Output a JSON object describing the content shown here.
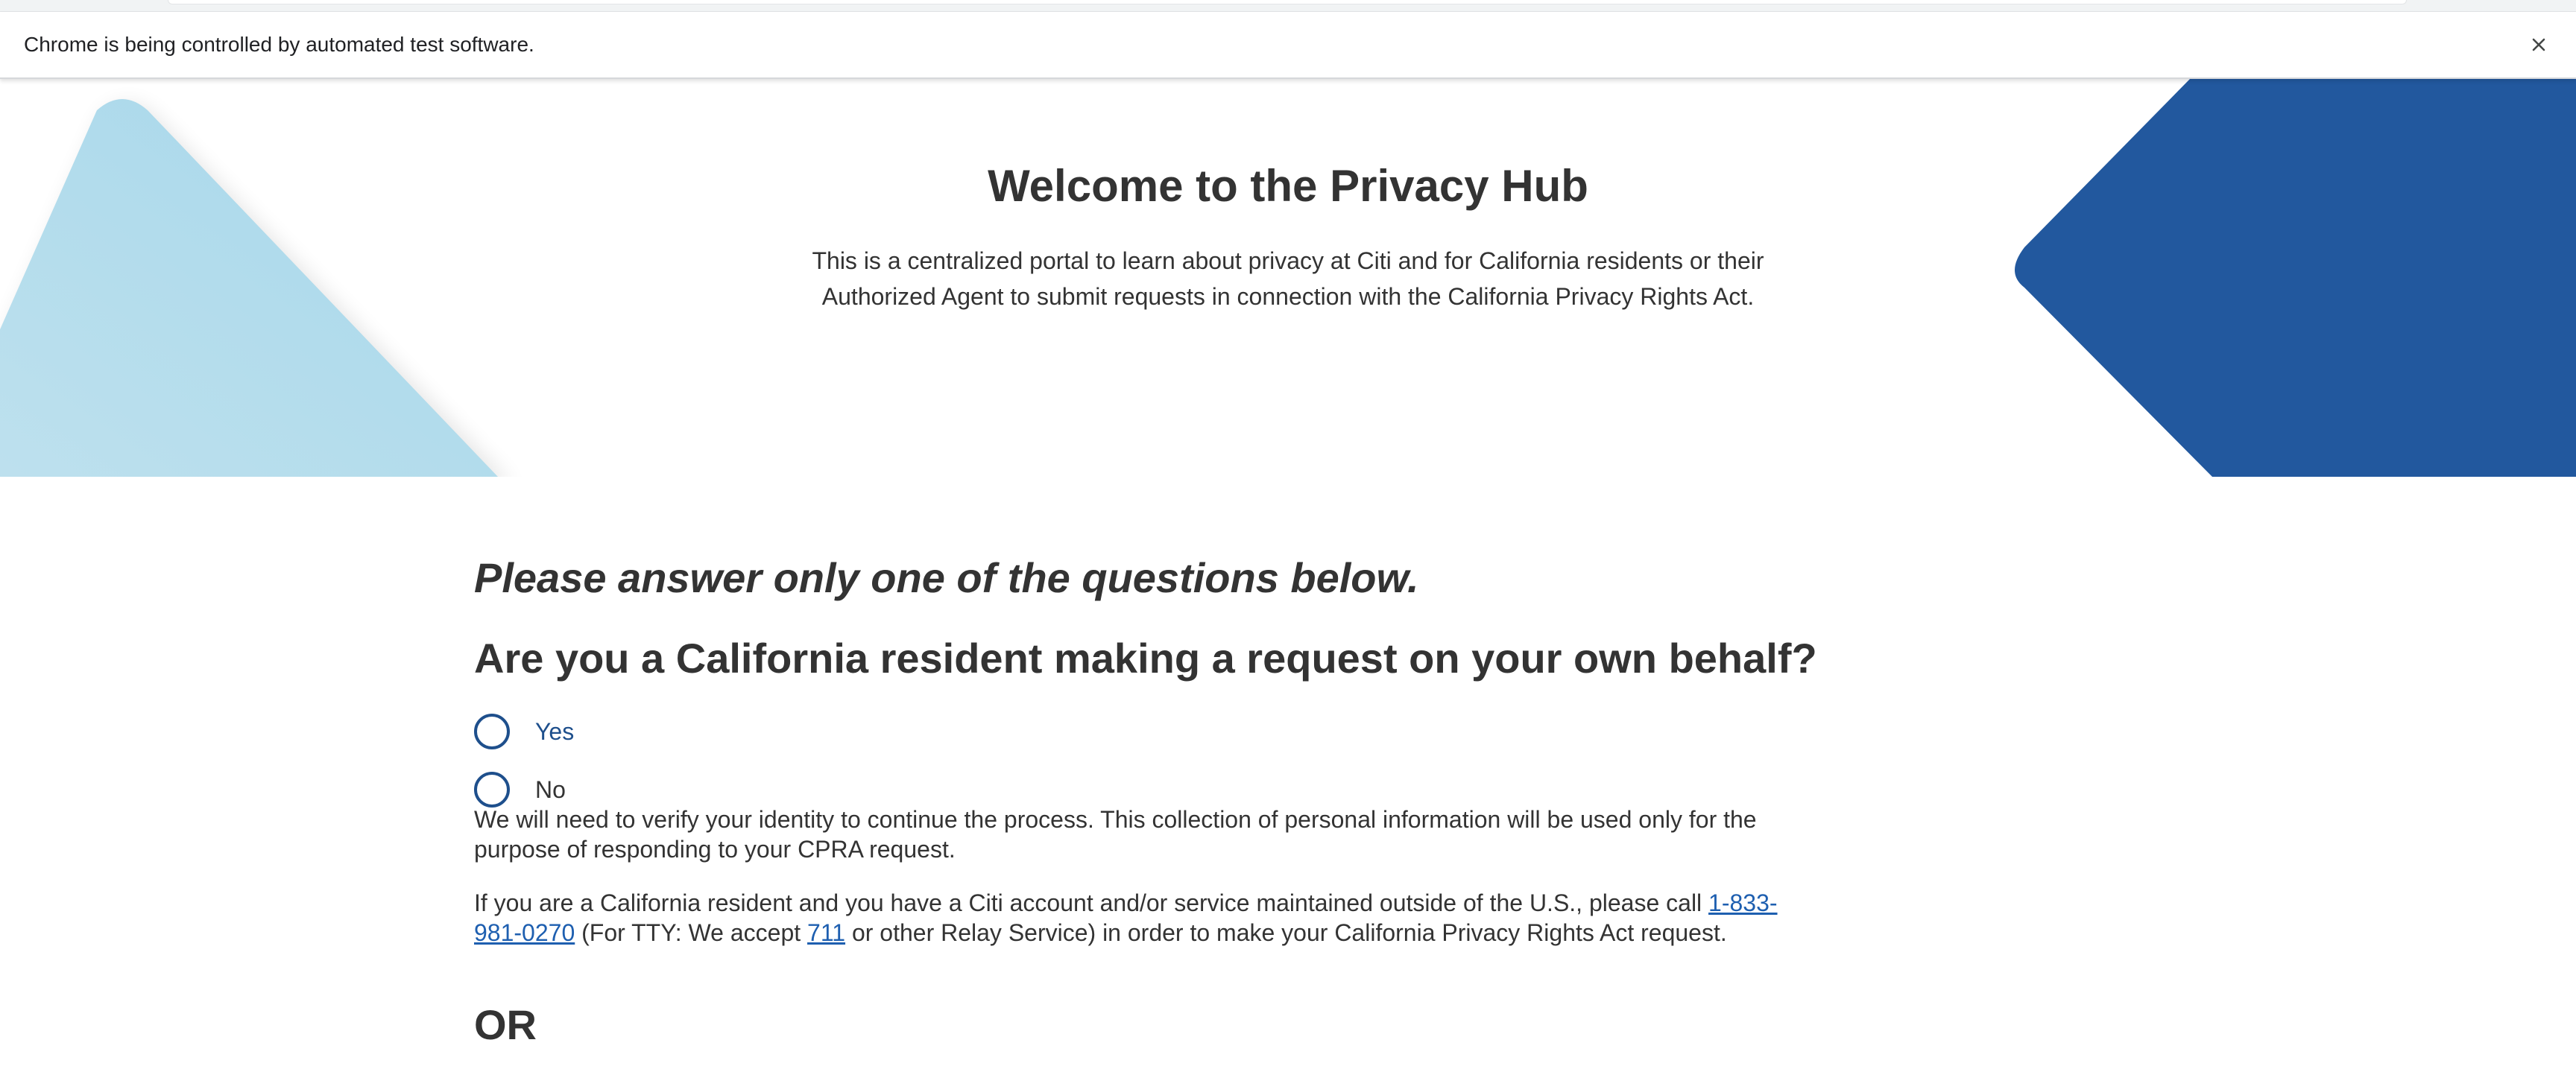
{
  "browser": {
    "infobar_message": "Chrome is being controlled by automated test software.",
    "close_icon": "close-icon"
  },
  "hero": {
    "title": "Welcome to the Privacy Hub",
    "description": "This is a centralized portal to learn about privacy at Citi and for California residents or their Authorized Agent to submit requests in connection with the California Privacy Rights Act.",
    "colors": {
      "left_shape": "#acdaea",
      "right_shape": "#22589e"
    }
  },
  "form": {
    "instruction": "Please answer only one of the questions below.",
    "question": "Are you a California resident making a request on your own behalf?",
    "options": [
      {
        "label": "Yes",
        "selected": false
      },
      {
        "label": "No",
        "selected": false
      }
    ],
    "verify_text": "We will need to verify your identity to continue the process. This collection of personal information will be used only for the purpose of responding to your CPRA request.",
    "outside_us": {
      "text_before": "If you are a California resident and you have a Citi account and/or service maintained outside of the U.S., please call ",
      "phone_link": "1-833-981-0270",
      "text_middle": " (For TTY: We accept ",
      "tty_link": "711",
      "text_after": " or other Relay Service) in order to make your California Privacy Rights Act request."
    },
    "or_label": "OR"
  },
  "colors": {
    "accent": "#1e4f8c",
    "link": "#1e5fb0",
    "text": "#333333"
  }
}
